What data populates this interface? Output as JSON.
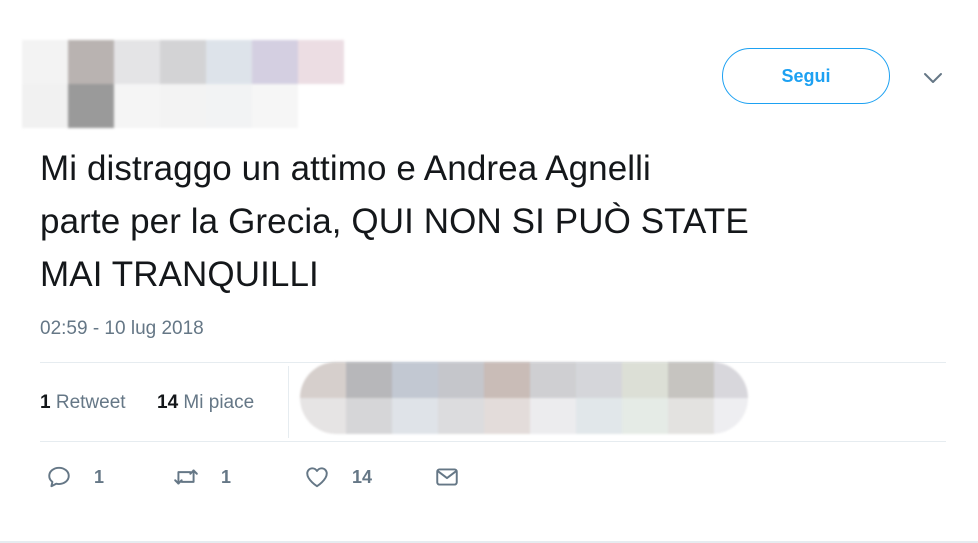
{
  "header": {
    "follow_label": "Segui"
  },
  "tweet": {
    "line1": "Mi distraggo un attimo e Andrea Agnelli",
    "line2": "parte per la Grecia, QUI NON SI PUÒ STATE",
    "line3": "MAI TRANQUILLI",
    "timestamp": "02:59 - 10 lug 2018"
  },
  "stats": {
    "retweets_count": "1",
    "retweets_label": "Retweet",
    "likes_count": "14",
    "likes_label": "Mi piace"
  },
  "actions": {
    "reply_count": "1",
    "retweet_count": "1",
    "like_count": "14"
  },
  "colors": {
    "accent": "#1da1f2",
    "muted": "#657786",
    "text": "#14171a",
    "divider": "#e6ecf0"
  },
  "icons": {
    "reply": "reply-icon",
    "retweet": "retweet-icon",
    "like": "heart-icon",
    "message": "envelope-icon",
    "more": "chevron-down-icon"
  }
}
